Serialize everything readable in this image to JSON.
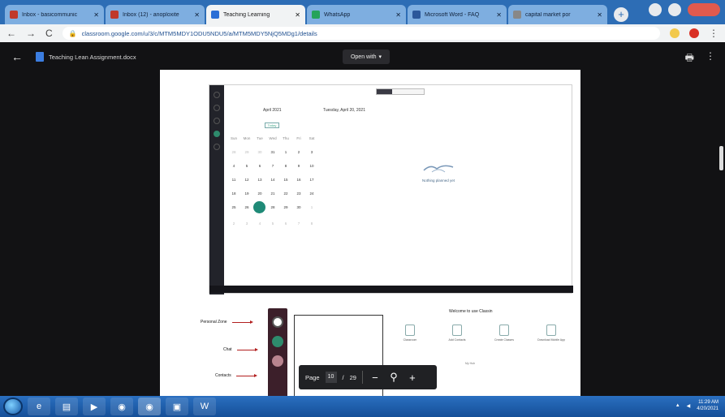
{
  "tabs": [
    {
      "title": "Inbox - basicommunic",
      "color": "#c0392b",
      "active": false
    },
    {
      "title": "Inbox (12) - anoploxite",
      "color": "#c0392b",
      "active": false
    },
    {
      "title": "Teaching Learning",
      "color": "#2b6fd6",
      "active": true
    },
    {
      "title": "WhatsApp",
      "color": "#25a35a",
      "active": false
    },
    {
      "title": "Microsoft Word - FAQ",
      "color": "#2b579a",
      "active": false
    },
    {
      "title": "capital market por",
      "color": "#888888",
      "active": false
    }
  ],
  "address": {
    "url": "classroom.google.com/u/3/c/MTM5MDY1ODU5NDU5/a/MTM5MDY5NjQ5MDg1/details"
  },
  "viewer": {
    "doc_name": "Teaching Lean Assignment.docx",
    "open_with": "Open with"
  },
  "page_controls": {
    "label": "Page",
    "current": "10",
    "sep": "/",
    "total": "29"
  },
  "doc": {
    "month": "April 2021",
    "date_line": "Tuesday, April 20, 2021",
    "today": "Today",
    "empty_text": "Nothing planned yet",
    "cal_headers": [
      "Sun",
      "Mon",
      "Tue",
      "Wed",
      "Thu",
      "Fri",
      "Sat"
    ],
    "cal_rows": [
      [
        "28",
        "29",
        "30",
        "31",
        "1",
        "2",
        "3"
      ],
      [
        "4",
        "5",
        "6",
        "7",
        "8",
        "9",
        "10"
      ],
      [
        "11",
        "12",
        "13",
        "14",
        "15",
        "16",
        "17"
      ],
      [
        "18",
        "19",
        "20",
        "21",
        "22",
        "23",
        "24"
      ],
      [
        "25",
        "26",
        "27",
        "28",
        "29",
        "30",
        "1"
      ],
      [
        "2",
        "3",
        "4",
        "5",
        "6",
        "7",
        "8"
      ]
    ],
    "annotations": [
      "Personal Zone",
      "Chat",
      "Contacts"
    ],
    "welcome": "Welcome to use Classin",
    "cards": [
      "Classroom",
      "Add Contacts",
      "Create Classes",
      "Download Mobile App"
    ],
    "faint": "My Hub"
  },
  "tray": {
    "time": "11:29 AM",
    "date": "4/20/2021"
  }
}
